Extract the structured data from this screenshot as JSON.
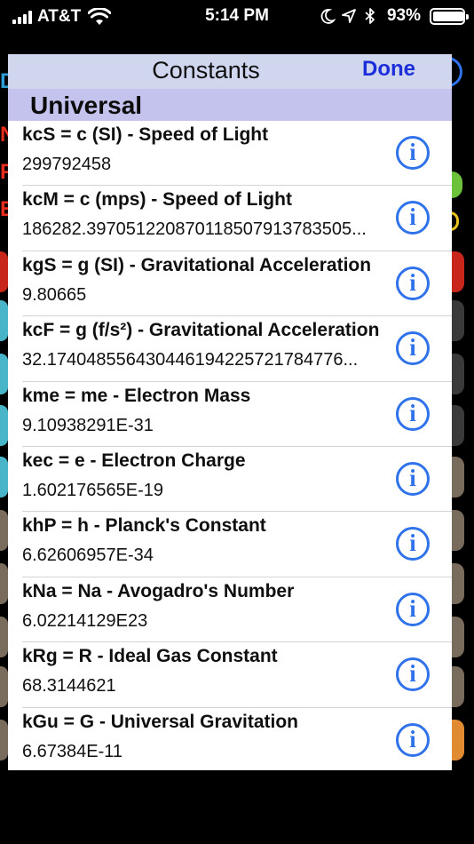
{
  "status_bar": {
    "carrier": "AT&T",
    "time": "5:14 PM",
    "battery": "93%",
    "icons": [
      "signal-icon",
      "wifi-icon",
      "moon-icon",
      "location-icon",
      "bluetooth-icon",
      "battery-icon"
    ]
  },
  "nav": {
    "title": "Constants",
    "done_label": "Done"
  },
  "section": {
    "title": "Universal"
  },
  "constants": [
    {
      "title": "kcS = c (SI) - Speed of Light",
      "value": "299792458"
    },
    {
      "title": "kcM = c (mps) - Speed of Light",
      "value": "186282.397051220870118507913783505..."
    },
    {
      "title": "kgS = g (SI) - Gravitational Acceleration",
      "value": "9.80665"
    },
    {
      "title": "kcF = g (f/s²) - Gravitational Acceleration",
      "value": "32.174048556430446194225721784776..."
    },
    {
      "title": "kme = me - Electron Mass",
      "value": "9.10938291E-31"
    },
    {
      "title": "kec = e - Electron Charge",
      "value": "1.602176565E-19"
    },
    {
      "title": "khP = h - Planck's Constant",
      "value": "6.62606957E-34"
    },
    {
      "title": "kNa = Na - Avogadro's Number",
      "value": "6.02214129E23"
    },
    {
      "title": "kRg = R - Ideal Gas Constant",
      "value": "68.3144621"
    },
    {
      "title": "kGu = G - Universal Gravitation",
      "value": "6.67384E-11"
    }
  ],
  "info_glyph": "i",
  "colors": {
    "nav_bar": "#cfd6ed",
    "section_header": "#c4c3ee",
    "done": "#1d2fdb",
    "info": "#2f72ea"
  }
}
